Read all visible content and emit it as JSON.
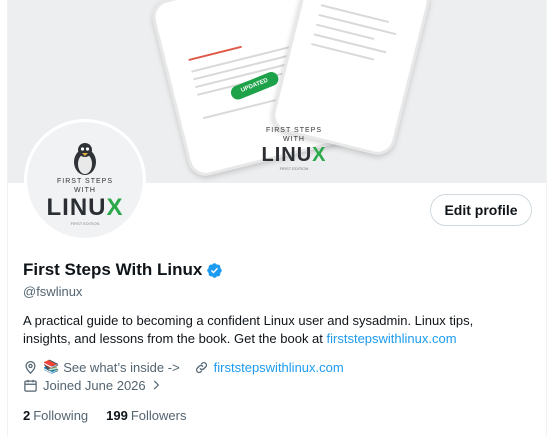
{
  "banner": {
    "logo_top": "FIRST STEPS",
    "logo_mid": "WITH",
    "logo_main": "LINU",
    "logo_x": "X",
    "logo_edition": "FIRST EDITION",
    "updated_pill": "UPDATED"
  },
  "avatar": {
    "top": "FIRST STEPS",
    "mid": "WITH",
    "main": "LINU",
    "x": "X",
    "edition": "FIRST EDITION"
  },
  "profile": {
    "edit_label": "Edit profile",
    "name": "First Steps With Linux",
    "handle": "@fswlinux",
    "bio_text": "A practical guide to becoming a confident Linux user and sysadmin. Linux tips, insights, and lessons from the book. Get the book at ",
    "bio_link": "firststepswithlinux.com",
    "location_text": "See what’s inside ->",
    "website": "firststepswithlinux.com",
    "joined": "Joined June 2026",
    "following_count": "2",
    "following_label": "Following",
    "followers_count": "199",
    "followers_label": "Followers"
  },
  "colors": {
    "accent": "#1d9bf0",
    "secondary_text": "#536471",
    "brand_green": "#2aa84a"
  },
  "icons": [
    "location-icon",
    "books-icon",
    "link-icon",
    "calendar-icon",
    "chevron-right-icon",
    "verified-badge-icon"
  ]
}
